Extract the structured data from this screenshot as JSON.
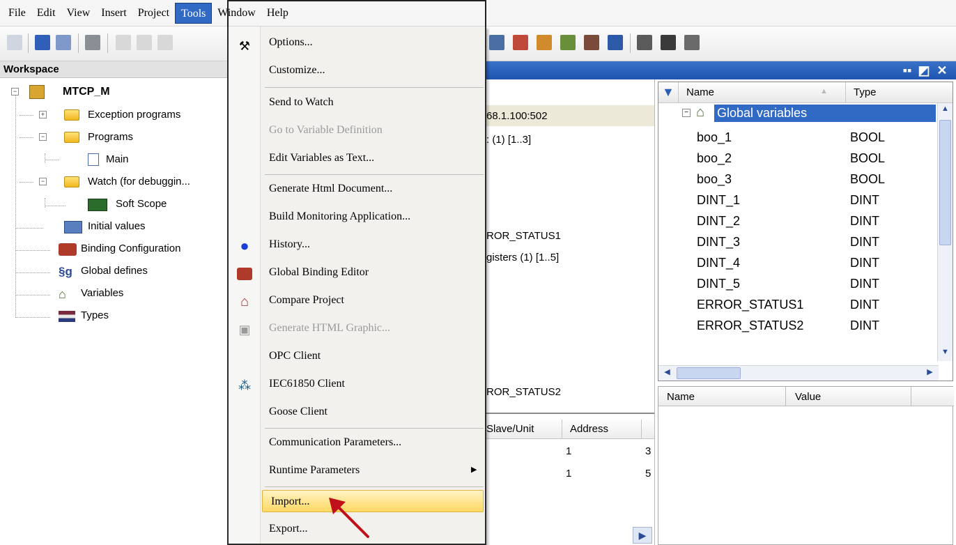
{
  "menubar": {
    "items": [
      "File",
      "Edit",
      "View",
      "Insert",
      "Project",
      "Tools",
      "Window",
      "Help"
    ],
    "open_menu": "Tools"
  },
  "workspace": {
    "title": "Workspace",
    "tree": [
      {
        "label": "MTCP_M"
      },
      {
        "label": "Exception programs"
      },
      {
        "label": "Programs"
      },
      {
        "label": "Main"
      },
      {
        "label": "Watch (for debuggin..."
      },
      {
        "label": "Soft Scope"
      },
      {
        "label": "Initial values"
      },
      {
        "label": "Binding Configuration"
      },
      {
        "label": "Global defines"
      },
      {
        "label": "Variables"
      },
      {
        "label": "Types"
      }
    ]
  },
  "center": {
    "lines": [
      "68.1.100:502",
      ": (1) [1..3]",
      "ROR_STATUS1",
      "gisters (1) [1..5]",
      "ROR_STATUS2"
    ],
    "table": {
      "headers": [
        "Slave/Unit",
        "Address"
      ],
      "rows": [
        [
          "1",
          "3"
        ],
        [
          "1",
          "5"
        ]
      ]
    }
  },
  "tools_menu": {
    "items": [
      {
        "label": "Options...",
        "icon": "tools-icon"
      },
      {
        "label": "Customize..."
      },
      {
        "label": "Send to Watch"
      },
      {
        "label": "Go to Variable Definition",
        "disabled": true
      },
      {
        "label": "Edit Variables as Text..."
      },
      {
        "label": "Generate Html Document..."
      },
      {
        "label": "Build Monitoring Application..."
      },
      {
        "label": "History...",
        "icon": "history-icon"
      },
      {
        "label": "Global Binding Editor",
        "icon": "binding-icon"
      },
      {
        "label": "Compare Project",
        "icon": "compare-icon"
      },
      {
        "label": "Generate HTML Graphic...",
        "disabled": true,
        "icon": "html-graphic-icon"
      },
      {
        "label": "OPC Client"
      },
      {
        "label": "IEC61850 Client",
        "icon": "iec61850-icon"
      },
      {
        "label": "Goose Client"
      },
      {
        "label": "Communication Parameters..."
      },
      {
        "label": "Runtime Parameters",
        "submenu": true
      },
      {
        "label": "Import...",
        "highlighted": true
      },
      {
        "label": "Export..."
      }
    ]
  },
  "variables": {
    "headers": {
      "name": "Name",
      "type": "Type"
    },
    "group": "Global variables",
    "rows": [
      {
        "name": "boo_1",
        "type": "BOOL"
      },
      {
        "name": "boo_2",
        "type": "BOOL"
      },
      {
        "name": "boo_3",
        "type": "BOOL"
      },
      {
        "name": "DINT_1",
        "type": "DINT"
      },
      {
        "name": "DINT_2",
        "type": "DINT"
      },
      {
        "name": "DINT_3",
        "type": "DINT"
      },
      {
        "name": "DINT_4",
        "type": "DINT"
      },
      {
        "name": "DINT_5",
        "type": "DINT"
      },
      {
        "name": "ERROR_STATUS1",
        "type": "DINT"
      },
      {
        "name": "ERROR_STATUS2",
        "type": "DINT"
      }
    ]
  },
  "watch": {
    "headers": {
      "name": "Name",
      "value": "Value"
    }
  },
  "colors": {
    "title_bar": "#2a62bd",
    "highlight": "#ffd864",
    "arrow": "#c0111b"
  }
}
